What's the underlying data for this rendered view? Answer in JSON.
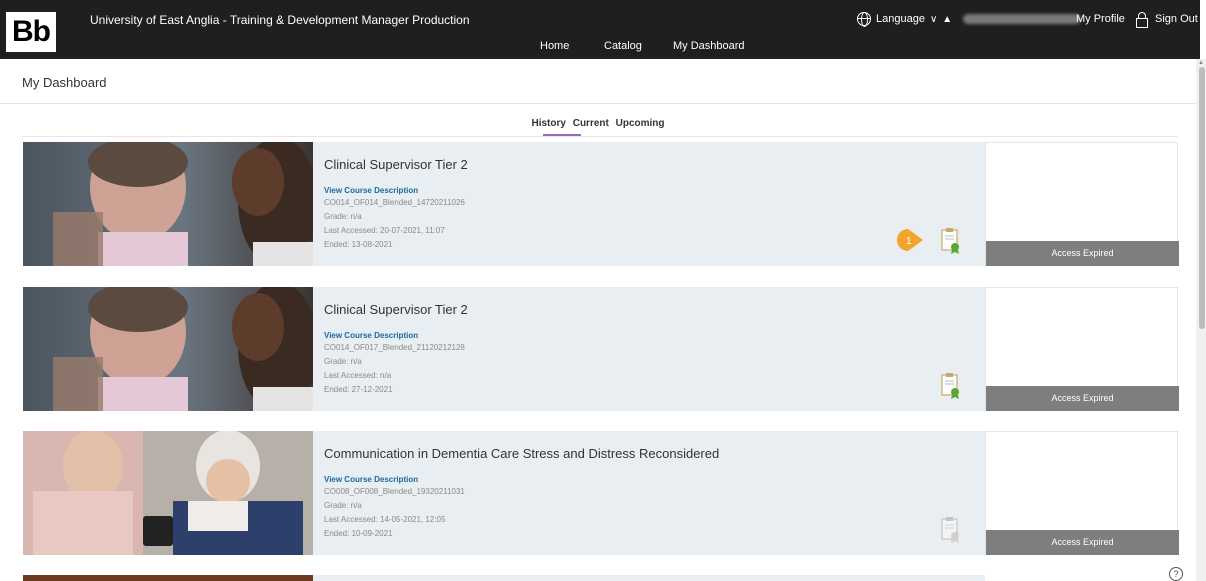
{
  "header": {
    "logo": "Bb",
    "site_title": "University of East Anglia - Training & Development Manager Production",
    "language_label": "Language",
    "profile_label": "My Profile",
    "signout_label": "Sign Out"
  },
  "nav": {
    "items": [
      "Home",
      "Catalog",
      "My Dashboard"
    ]
  },
  "page": {
    "title": "My Dashboard"
  },
  "tabs": [
    "History",
    "Current",
    "Upcoming"
  ],
  "courses": [
    {
      "title": "Clinical Supervisor Tier 2",
      "link": "View Course Description",
      "code": "CO014_OF014_Blended_14720211026",
      "grade": "Grade: n/a",
      "last_accessed": "Last Accessed: 20-07-2021, 11:07",
      "ended": "Ended: 13-08-2021",
      "status": "Access Expired",
      "badge": "1"
    },
    {
      "title": "Clinical Supervisor Tier 2",
      "link": "View Course Description",
      "code": "CO014_OF017_Blended_21120212128",
      "grade": "Grade: n/a",
      "last_accessed": "Last Accessed: n/a",
      "ended": "Ended: 27-12-2021",
      "status": "Access Expired"
    },
    {
      "title": "Communication in Dementia Care Stress and Distress Reconsidered",
      "link": "View Course Description",
      "code": "CO008_OF008_Blended_19320211031",
      "grade": "Grade: n/a",
      "last_accessed": "Last Accessed: 14-05-2021, 12:05",
      "ended": "Ended: 10-09-2021",
      "status": "Access Expired"
    }
  ],
  "help_label": "?",
  "colors": {
    "accent": "#9c68b8",
    "link": "#1a6aa3",
    "header_bg": "#1f1f1f",
    "expired_bg": "#7e7e7e",
    "cert_green": "#5aa832"
  }
}
